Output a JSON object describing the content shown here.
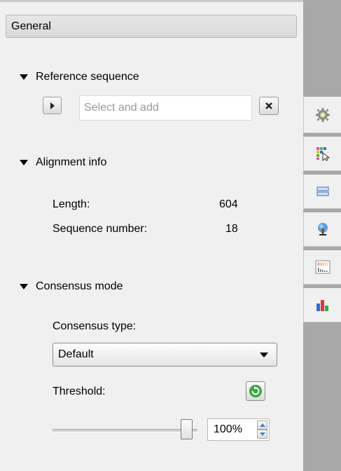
{
  "general": {
    "title": "General"
  },
  "reference": {
    "header": "Reference sequence",
    "placeholder": "Select and add",
    "go_icon": "chevron-right-icon",
    "clear_icon": "close-icon"
  },
  "alignment": {
    "header": "Alignment info",
    "length_label": "Length:",
    "length_value": "604",
    "seqnum_label": "Sequence number:",
    "seqnum_value": "18"
  },
  "consensus": {
    "header": "Consensus mode",
    "type_label": "Consensus type:",
    "type_value": "Default",
    "threshold_label": "Threshold:",
    "threshold_value": "100%",
    "threshold_fraction": 1.0
  },
  "tabs": [
    {
      "name": "general-settings",
      "icon": "gear-icon"
    },
    {
      "name": "highlighting",
      "icon": "highlight-cursor-icon"
    },
    {
      "name": "overview",
      "icon": "overview-icon"
    },
    {
      "name": "tree-settings",
      "icon": "tree-icon"
    },
    {
      "name": "statistics",
      "icon": "statistics-icon"
    },
    {
      "name": "charts",
      "icon": "bar-chart-icon"
    }
  ],
  "colors": {
    "panel_bg": "#f0f0f0",
    "strip_bg": "#a8a8a8",
    "accent_green": "#3aa845",
    "accent_blue": "#4a7fc1"
  }
}
